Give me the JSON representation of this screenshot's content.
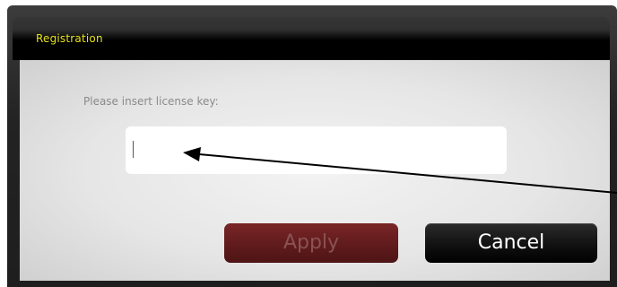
{
  "dialog": {
    "title": "Registration",
    "prompt": "Please insert license key:",
    "license_input": {
      "value": "",
      "placeholder": ""
    },
    "apply_label": "Apply",
    "cancel_label": "Cancel"
  },
  "colors": {
    "title_text": "#e6e21a",
    "apply_button": "#6b1f20",
    "cancel_button": "#111111"
  },
  "icons": [
    "arrow-annotation"
  ]
}
